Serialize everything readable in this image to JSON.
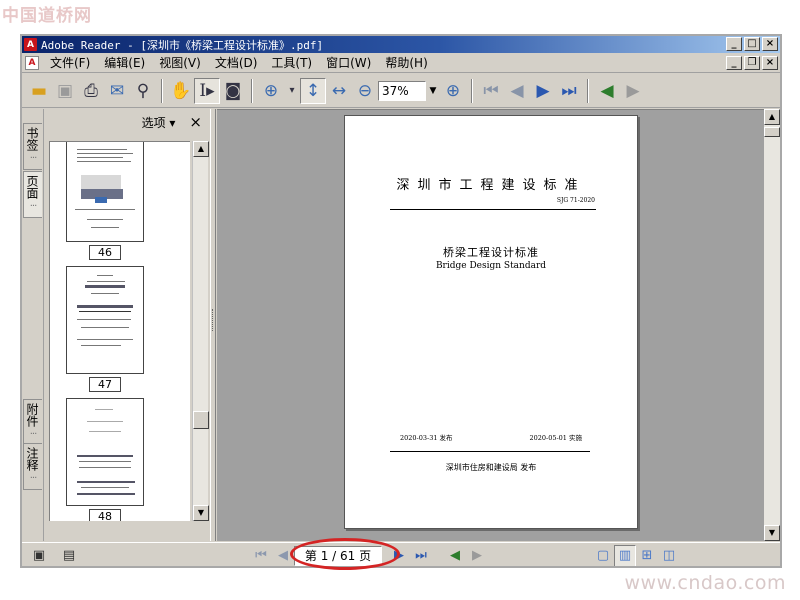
{
  "watermark": {
    "top": "中国道桥网",
    "bottom": "www.cndao.com"
  },
  "window": {
    "title": "Adobe Reader - [深圳市《桥梁工程设计标准》.pdf]",
    "app_icon": "adobe-reader-icon",
    "buttons": {
      "minimize": "_",
      "maximize": "□",
      "close": "×"
    }
  },
  "menu": {
    "items": [
      "文件(F)",
      "编辑(E)",
      "视图(V)",
      "文档(D)",
      "工具(T)",
      "窗口(W)",
      "帮助(H)"
    ],
    "mdi_buttons": {
      "minimize": "_",
      "restore": "❐",
      "close": "×"
    }
  },
  "toolbar": {
    "zoom_value": "37%",
    "icons": [
      "open-folder-icon",
      "save-icon",
      "print-icon",
      "email-icon",
      "search-binoculars-icon",
      "hand-tool-icon",
      "select-text-icon",
      "snapshot-icon",
      "zoom-in-icon",
      "fit-height-icon",
      "fit-width-icon",
      "zoom-out-icon",
      "zoom-plus-icon",
      "first-page-icon",
      "prev-page-icon",
      "next-page-icon",
      "last-page-icon",
      "go-back-icon",
      "go-forward-icon"
    ]
  },
  "side_tabs": {
    "bookmarks": "书签",
    "pages": "页面",
    "attachments": "附件",
    "comments": "注释"
  },
  "panel": {
    "options_label": "选项",
    "close_label": "×",
    "thumbnails": [
      {
        "page_label": "46"
      },
      {
        "page_label": "47"
      },
      {
        "page_label": "48"
      }
    ]
  },
  "document": {
    "standard_header": "深圳市工程建设标准",
    "standard_code": "SJG 71-2020",
    "title_cn": "桥梁工程设计标准",
    "title_en": "Bridge Design Standard",
    "publish_date": "2020-03-31 发布",
    "effective_date": "2020-05-01 实施",
    "publisher": "深圳市住房和建设局   发布"
  },
  "statusbar": {
    "page_indicator": "第 1 / 61 页"
  },
  "colors": {
    "title_bar": "#0a246a",
    "viewer_bg": "#a0a0a0",
    "highlight_ring": "#d42424"
  }
}
